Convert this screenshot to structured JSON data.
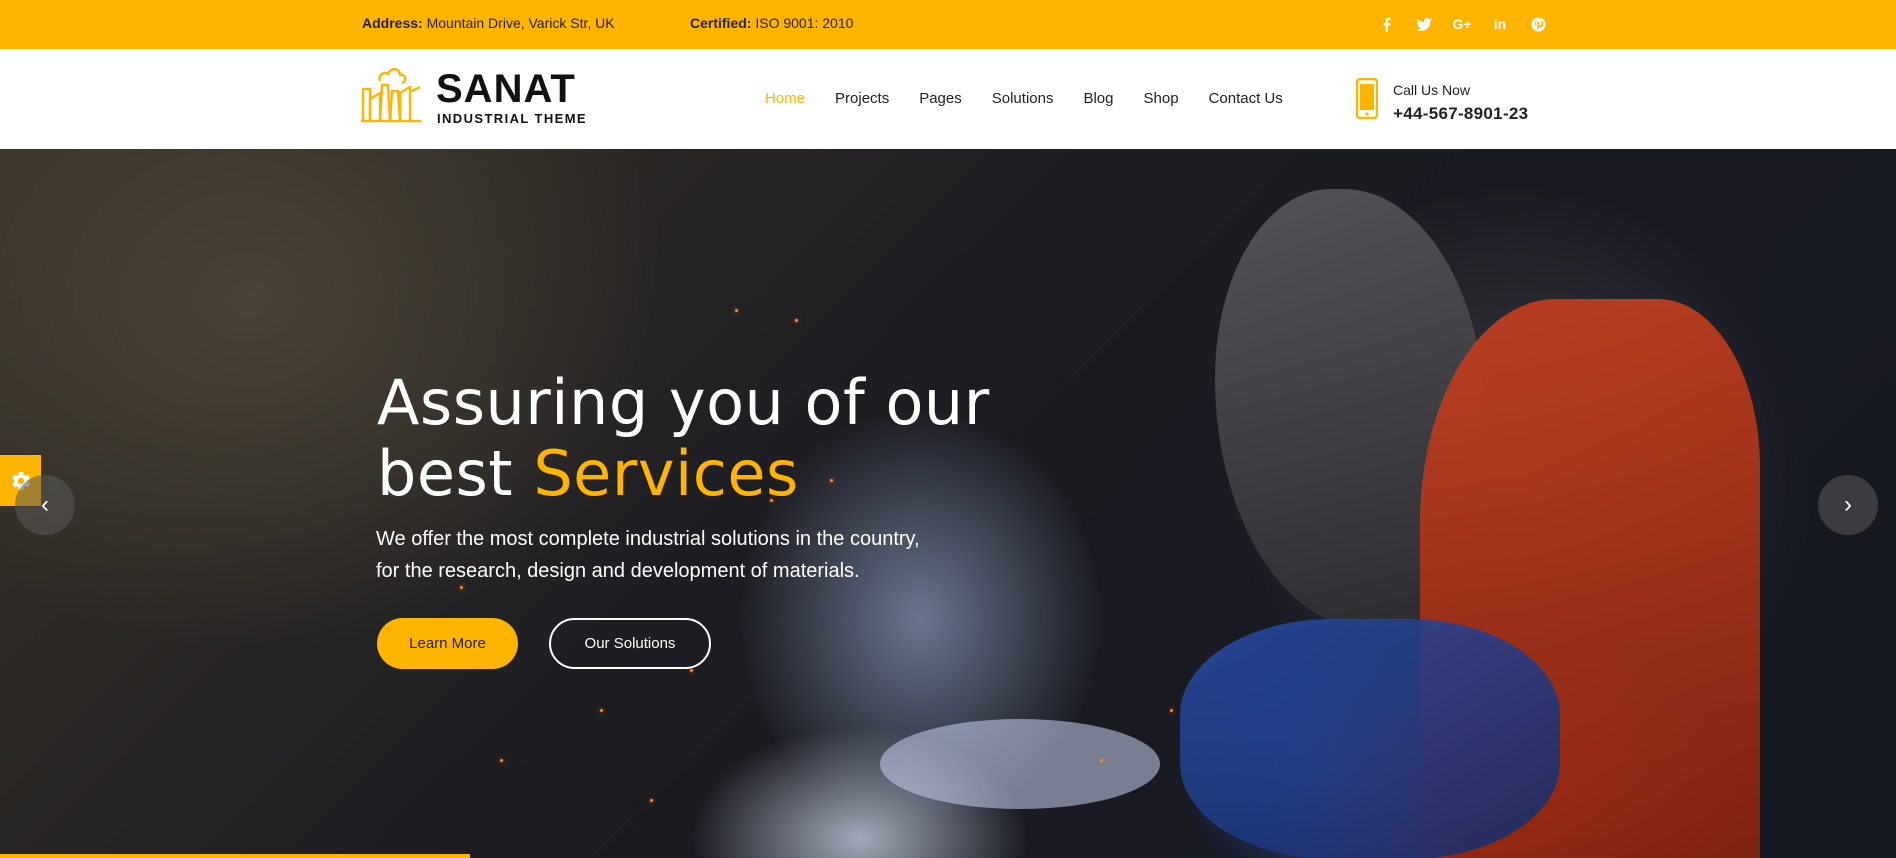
{
  "topbar": {
    "address_label": "Address:",
    "address_value": "Mountain Drive, Varick Str, UK",
    "certified_label": "Certified:",
    "certified_value": "ISO 9001: 2010",
    "social": [
      {
        "name": "facebook-icon",
        "glyph": "f"
      },
      {
        "name": "twitter-icon",
        "glyph": "🐦"
      },
      {
        "name": "google-plus-icon",
        "glyph": "G+"
      },
      {
        "name": "linkedin-icon",
        "glyph": "in"
      },
      {
        "name": "pinterest-icon",
        "glyph": "℗"
      }
    ]
  },
  "header": {
    "logo_name": "SANAT",
    "logo_sub": "INDUSTRIAL THEME",
    "nav": [
      "Home",
      "Projects",
      "Pages",
      "Solutions",
      "Blog",
      "Shop",
      "Contact Us"
    ],
    "active_nav": "Home",
    "call_label": "Call Us Now",
    "call_number": "+44-567-8901-23"
  },
  "hero": {
    "title_line1": "Assuring you of our",
    "title_line2_plain": "best ",
    "title_line2_accent": "Services",
    "text_line1": "We offer the most complete industrial solutions in the country,",
    "text_line2": "for the research, design and development of materials.",
    "primary_button": "Learn More",
    "secondary_button": "Our Solutions",
    "prev_arrow": "‹",
    "next_arrow": "›"
  },
  "colors": {
    "accent": "#ffb400",
    "text_dark": "#222222"
  }
}
